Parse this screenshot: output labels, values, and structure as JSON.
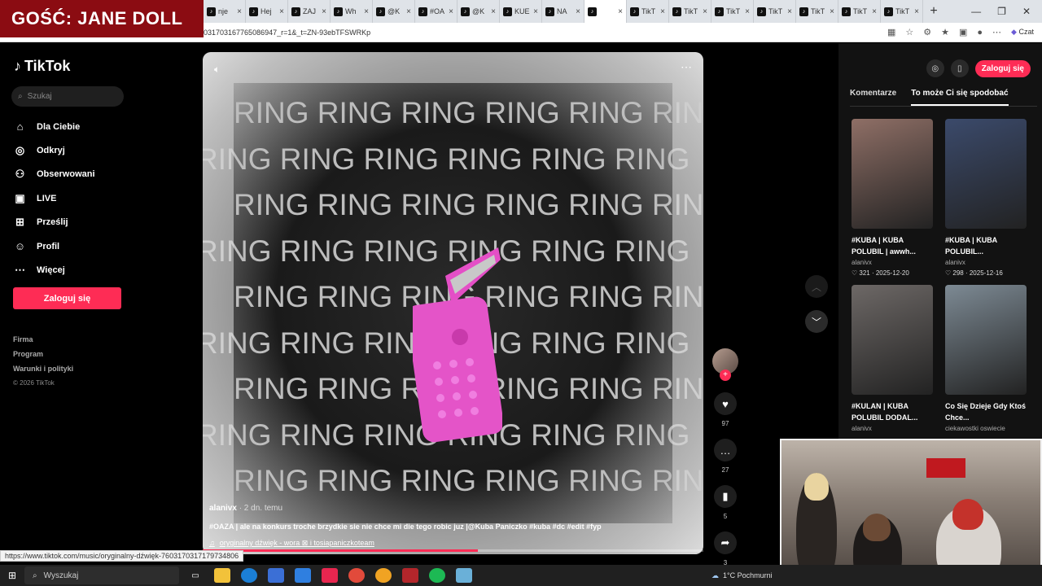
{
  "overlay": {
    "guest_banner": "GOŚĆ: JANE DOLL"
  },
  "browser": {
    "tabs": [
      {
        "label": "nje",
        "active": false
      },
      {
        "label": "Hej",
        "active": false
      },
      {
        "label": "ZAJ",
        "active": false
      },
      {
        "label": "Wh",
        "active": false
      },
      {
        "label": "@K",
        "active": false
      },
      {
        "label": "#OA",
        "active": false
      },
      {
        "label": "@K",
        "active": false
      },
      {
        "label": "KUE",
        "active": false
      },
      {
        "label": "NA",
        "active": false
      },
      {
        "label": "",
        "active": true
      },
      {
        "label": "TikT",
        "active": false
      },
      {
        "label": "TikT",
        "active": false
      },
      {
        "label": "TikT",
        "active": false
      },
      {
        "label": "TikT",
        "active": false
      },
      {
        "label": "TikT",
        "active": false
      },
      {
        "label": "TikT",
        "active": false
      },
      {
        "label": "TikT",
        "active": false
      }
    ],
    "url": "031703167765086947_r=1&_t=ZN-93ebTFSWRKp",
    "copilot_label": "Czat"
  },
  "sidebar": {
    "logo": "TikTok",
    "search_placeholder": "Szukaj",
    "items": [
      {
        "label": "Dla Ciebie",
        "icon": "home-icon"
      },
      {
        "label": "Odkryj",
        "icon": "compass-icon"
      },
      {
        "label": "Obserwowani",
        "icon": "following-icon"
      },
      {
        "label": "LIVE",
        "icon": "live-icon"
      },
      {
        "label": "Prześlij",
        "icon": "upload-icon"
      },
      {
        "label": "Profil",
        "icon": "profile-icon"
      },
      {
        "label": "Więcej",
        "icon": "more-icon"
      }
    ],
    "login_label": "Zaloguj się",
    "footer": [
      "Firma",
      "Program",
      "Warunki i polityki"
    ],
    "copyright": "© 2026 TikTok"
  },
  "video": {
    "ring_text": "RING RING RING RING RING RING",
    "author": "alanivx",
    "time": "· 2 dn. temu",
    "caption": "#OAZA | ale na konkurs troche brzydkie sie nie chce mi die tego robic juz |@Kuba Paniczko #kuba #dc #edit #fyp",
    "sound": "oryginalny dźwięk - wora ⊠ i tosiapaniczkoteam",
    "progress": 0.55
  },
  "actions": {
    "likes": "97",
    "comments": "27",
    "saves": "5",
    "shares": "3"
  },
  "right_panel": {
    "login_label": "Zaloguj się",
    "tabs": [
      {
        "label": "Komentarze",
        "active": false
      },
      {
        "label": "To może Ci się spodobać",
        "active": true
      }
    ],
    "cards": [
      {
        "title": "#KUBA | KUBA POLUBIL | awwh...",
        "author": "alanivx",
        "meta": "♡ 321 · 2025-12-20",
        "color": "#8f6f66"
      },
      {
        "title": "#KUBA | KUBA POLUBIL...",
        "author": "alanivx",
        "meta": "♡ 298 · 2025-12-16",
        "color": "#3b4a6b"
      },
      {
        "title": "#KULAN | KUBA POLUBIL DODAL...",
        "author": "alanivx",
        "meta": "",
        "color": "#6d6866"
      },
      {
        "title": "Co Się Dzieje Gdy Ktoś Chce...",
        "author": "ciekawostki oswiecie",
        "meta": "",
        "color": "#7d8a94"
      }
    ]
  },
  "status_url": "https://www.tiktok.com/music/oryginalny-dźwięk-7603170317179734806",
  "taskbar": {
    "search_label": "Wyszukaj",
    "weather": "1°C Pochmurni"
  }
}
